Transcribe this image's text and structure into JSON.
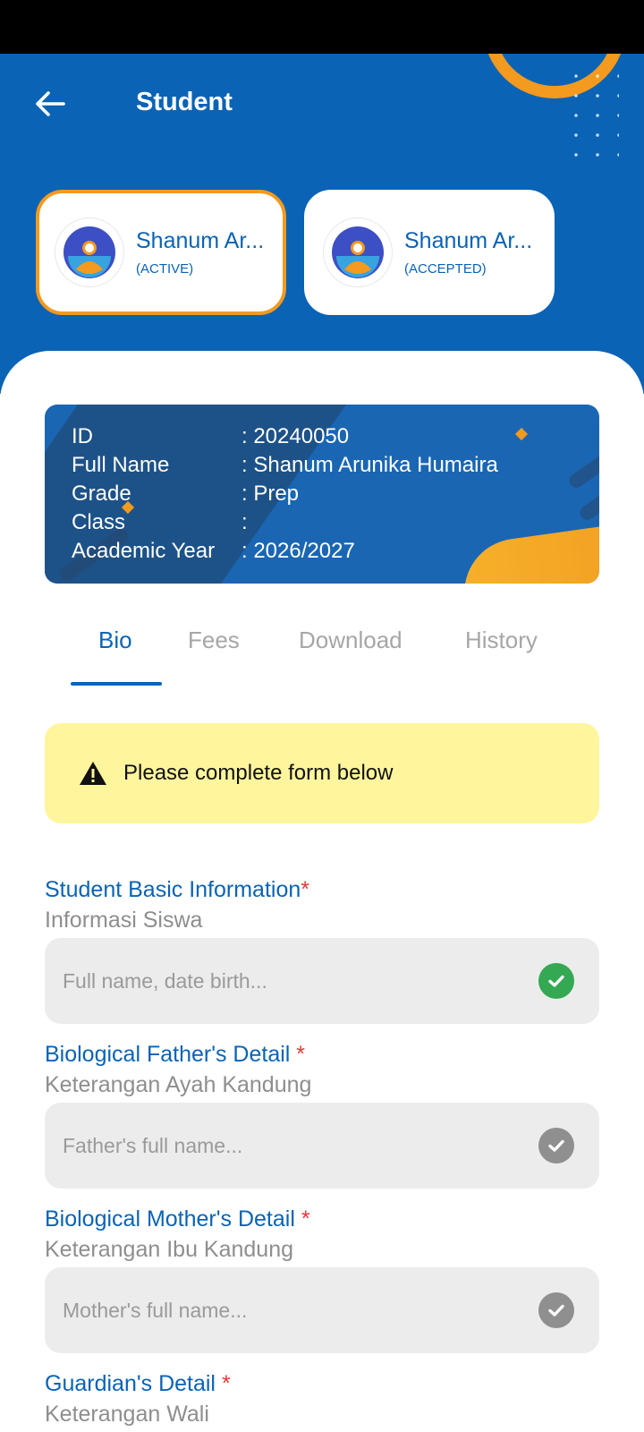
{
  "header": {
    "title": "Student"
  },
  "students": [
    {
      "name": "Shanum Ar...",
      "status": "(ACTIVE)"
    },
    {
      "name": "Shanum Ar...",
      "status": "(ACCEPTED)"
    }
  ],
  "id_card": {
    "rows": [
      {
        "label": "ID",
        "value": ": 20240050"
      },
      {
        "label": "Full Name",
        "value": ": Shanum Arunika Humaira"
      },
      {
        "label": "Grade",
        "value": ": Prep"
      },
      {
        "label": "Class",
        "value": ":"
      },
      {
        "label": "Academic Year",
        "value": ": 2026/2027"
      }
    ]
  },
  "tabs": [
    {
      "label": "Bio",
      "active": true
    },
    {
      "label": "Fees",
      "active": false
    },
    {
      "label": "Download",
      "active": false
    },
    {
      "label": "History",
      "active": false
    }
  ],
  "alert": {
    "text": "Please complete form below"
  },
  "sections": [
    {
      "title": "Student Basic Information",
      "required": "*",
      "subtitle": "Informasi Siswa",
      "placeholder": "Full name, date birth...",
      "status": "complete"
    },
    {
      "title": "Biological Father's Detail",
      "required": "*",
      "subtitle": "Keterangan Ayah Kandung",
      "placeholder": "Father's full name...",
      "status": "pending"
    },
    {
      "title": "Biological Mother's Detail",
      "required": "*",
      "subtitle": "Keterangan Ibu Kandung",
      "placeholder": "Mother's full name...",
      "status": "pending"
    },
    {
      "title": "Guardian's Detail",
      "required": "*",
      "subtitle": "Keterangan Wali"
    }
  ],
  "colors": {
    "primary": "#0a63b5",
    "accent": "#f39a1f",
    "alert_bg": "#fff59d",
    "success": "#34a853",
    "required": "#e53935"
  },
  "icons": {
    "back": "arrow-left-icon",
    "alert": "warning-icon",
    "avatar": "student-avatar-icon",
    "check": "check-circle-icon"
  }
}
